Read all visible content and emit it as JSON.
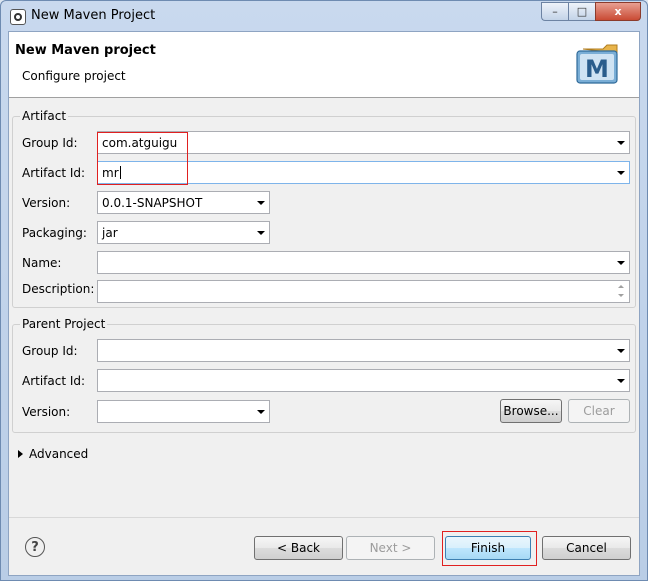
{
  "window": {
    "title": "New Maven Project",
    "buttons": {
      "minimize": "–",
      "maximize": "□",
      "close": "x"
    }
  },
  "banner": {
    "title": "New Maven project",
    "subtitle": "Configure project",
    "logo_text": "M",
    "logo_icon": "maven-logo-icon"
  },
  "artifact": {
    "legend": "Artifact",
    "group_id_label": "Group Id:",
    "group_id_value": "com.atguigu",
    "artifact_id_label": "Artifact Id:",
    "artifact_id_value": "mr",
    "version_label": "Version:",
    "version_value": "0.0.1-SNAPSHOT",
    "packaging_label": "Packaging:",
    "packaging_value": "jar",
    "name_label": "Name:",
    "name_value": "",
    "description_label": "Description:",
    "description_value": ""
  },
  "parent": {
    "legend": "Parent Project",
    "group_id_label": "Group Id:",
    "group_id_value": "",
    "artifact_id_label": "Artifact Id:",
    "artifact_id_value": "",
    "version_label": "Version:",
    "version_value": "",
    "browse_label": "Browse...",
    "clear_label": "Clear"
  },
  "advanced": {
    "label": "Advanced"
  },
  "footer": {
    "help_icon": "?",
    "back_label": "< Back",
    "next_label": "Next >",
    "finish_label": "Finish",
    "cancel_label": "Cancel"
  },
  "colors": {
    "highlight": "#e02020",
    "focus_border": "#7eb4ea",
    "default_button": "#3c7fb1"
  }
}
